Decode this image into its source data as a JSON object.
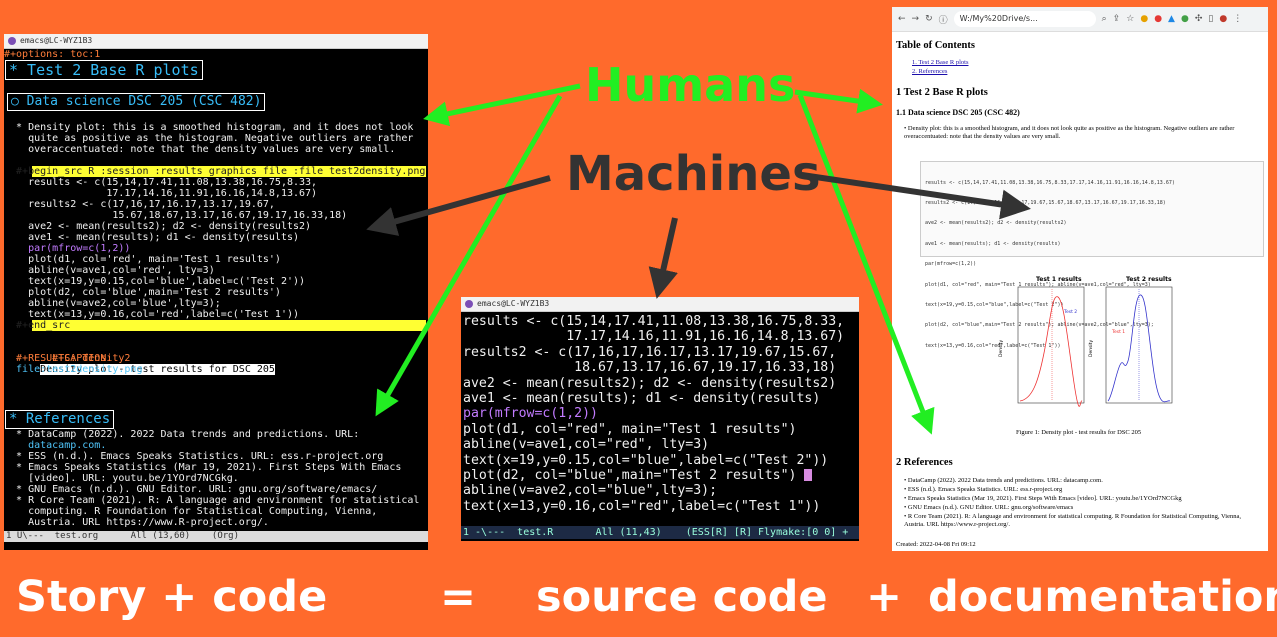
{
  "org_window": {
    "title": "emacs@LC-WYZ1B3",
    "options_line": "#+options: toc:1",
    "h1": "* Test 2 Base R plots",
    "h2": "○ Data science DSC 205 (CSC 482)",
    "bullet": [
      "  * Density plot: this is a smoothed histogram, and it does not look",
      "    quite as positive as the histogram. Negative outliers are rather",
      "    overaccentuated: note that the density values are very small."
    ],
    "begin_src": "  #+begin_src R :session :results graphics file :file test2density.png",
    "code": [
      "    results <- c(15,14,17.41,11.08,13.38,16.75,8.33,",
      "                 17.17,14.16,11.91,16.16,14.8,13.67)",
      "    results2 <- c(17,16,17,16.17,13.17,19.67,",
      "                  15.67,18.67,13.17,16.67,19.17,16.33,18)",
      "    ave2 <- mean(results2); d2 <- density(results2)",
      "    ave1 <- mean(results); d1 <- density(results)",
      "    par(mfrow=c(1,2))",
      "    plot(d1, col='red', main='Test 1 results')",
      "    abline(v=ave1,col='red', lty=3)",
      "    text(x=19,y=0.15,col='blue',label=c('Test 2'))",
      "    plot(d2, col='blue',main='Test 2 results')",
      "    abline(v=ave2,col='blue',lty=3);",
      "    text(x=13,y=0.16,col='red',label=c('Test 1'))"
    ],
    "end_src": "  #+end_src",
    "caption_key": "  #+CAPTION:",
    "caption_val": "Density plot - test results for DSC 205",
    "results_line": "  #+RESULTS: density2",
    "file_line": "  file:test2density.png",
    "references_heading": "* References",
    "references": [
      "  * DataCamp (2022). 2022 Data trends and predictions. URL:",
      "    datacamp.com.",
      "  * ESS (n.d.). Emacs Speaks Statistics. URL: ess.r-project.org",
      "  * Emacs Speaks Statistics (Mar 19, 2021). First Steps With Emacs",
      "    [video]. URL: youtu.be/1YOrd7NCGkg.",
      "  * GNU Emacs (n.d.). GNU Editor. URL: gnu.org/software/emacs/",
      "  * R Core Team (2021). R: A language and environment for statistical",
      "    computing. R Foundation for Statistical Computing, Vienna,",
      "    Austria. URL https://www.R-project.org/."
    ],
    "modeline": "1 U\\---  test.org      All (13,60)    (Org)"
  },
  "r_window": {
    "title": "emacs@LC-WYZ1B3",
    "lines": [
      "results <- c(15,14,17.41,11.08,13.38,16.75,8.33,",
      "             17.17,14.16,11.91,16.16,14.8,13.67)",
      "results2 <- c(17,16,17,16.17,13.17,19.67,15.67,",
      "              18.67,13.17,16.67,19.17,16.33,18)",
      "ave2 <- mean(results2); d2 <- density(results2)",
      "ave1 <- mean(results); d1 <- density(results)",
      "par(mfrow=c(1,2))",
      "plot(d1, col=\"red\", main=\"Test 1 results\")",
      "abline(v=ave1,col=\"red\", lty=3)",
      "text(x=19,y=0.15,col=\"blue\",label=c(\"Test 2\"))",
      "plot(d2, col=\"blue\",main=\"Test 2 results\") ",
      "abline(v=ave2,col=\"blue\",lty=3);",
      "text(x=13,y=0.16,col=\"red\",label=c(\"Test 1\"))"
    ],
    "modeline": "1 -\\---  test.R       All (11,43)    (ESS[R] [R] Flymake:[0 0] +"
  },
  "doc_window": {
    "url": "W:/My%20Drive/s...",
    "toc_title": "Table of Contents",
    "toc": [
      "1. Test 2 Base R plots",
      "2. References"
    ],
    "h1": "1 Test 2 Base R plots",
    "h2": "1.1 Data science DSC 205 (CSC 482)",
    "para": "Density plot: this is a smoothed histogram, and it does not look quite as positive as the histogram. Negative outliers are rather overaccentuated: note that the density values are very small.",
    "code": [
      "results <- c(15,14,17.41,11.08,13.38,16.75,8.33,17.17,14.16,11.91,16.16,14.8,13.67)",
      "results2 <- c(17,16,17,16.17,13.17,19.67,15.67,18.67,13.17,16.67,19.17,16.33,18)",
      "ave2 <- mean(results2); d2 <- density(results2)",
      "ave1 <- mean(results); d1 <- density(results)",
      "par(mfrow=c(1,2))",
      "plot(d1, col=\"red\", main=\"Test 1 results\"); abline(v=ave1,col=\"red\", lty=3)",
      "text(x=19,y=0.15,col=\"blue\",label=c(\"Test 2\"))",
      "plot(d2, col=\"blue\",main=\"Test 2 results\"); abline(v=ave2,col=\"blue\",lty=3);",
      "text(x=13,y=0.16,col=\"red\",label=c(\"Test 1\"))"
    ],
    "plot1_title": "Test 1 results",
    "plot2_title": "Test 2 results",
    "plot1_label": "Test 2",
    "plot2_label": "Test 1",
    "ylabel": "Density",
    "figure_caption": "Figure 1: Density plot - test results for DSC 205",
    "refs_heading": "2 References",
    "refs": [
      "DataCamp (2022). 2022 Data trends and predictions. URL: datacamp.com.",
      "ESS (n.d.). Emacs Speaks Statistics. URL: ess.r-project.org",
      "Emacs Speaks Statistics (Mar 19, 2021). First Steps With Emacs [video]. URL: youtu.be/1YOrd7NCGkg",
      "GNU Emacs (n.d.). GNU Editor. URL: gnu.org/software/emacs",
      "R Core Team (2021). R: A language and environment for statistical computing. R Foundation for Statistical Computing, Vienna, Austria. URL https://www.r-project.org/."
    ],
    "created": "Created: 2022-04-08 Fri 09:12"
  },
  "labels": {
    "humans": "Humans",
    "machines": "Machines",
    "story_code": "Story + code",
    "equals": "=",
    "source_code": "source code",
    "plus": "+",
    "documentation": "documentation"
  },
  "colors": {
    "background": "#ff6a2c",
    "humans_arrow": "#22ee22",
    "machines_arrow": "#333333"
  }
}
